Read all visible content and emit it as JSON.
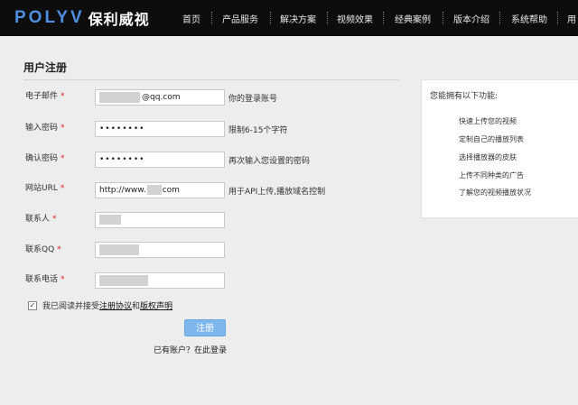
{
  "header": {
    "logo_latin": "POLYV",
    "logo_cn": "保利威视",
    "nav": [
      "首页",
      "产品服务",
      "解决方案",
      "视频效果",
      "经典案例",
      "版本介绍",
      "系统帮助",
      "用"
    ]
  },
  "form": {
    "title": "用户注册",
    "required_mark": "*",
    "fields": [
      {
        "label": "电子邮件",
        "value": "@qq.com",
        "hint": "你的登录账号"
      },
      {
        "label": "输入密码",
        "value": "••••••••",
        "hint": "限制6-15个字符"
      },
      {
        "label": "确认密码",
        "value": "••••••••",
        "hint": "再次输入您设置的密码"
      },
      {
        "label": "网站URL",
        "value_prefix": "http://www.",
        "value_suffix": "com",
        "hint": "用于API上传,播放域名控制"
      },
      {
        "label": "联系人",
        "value": "",
        "hint": ""
      },
      {
        "label": "联系QQ",
        "value": "",
        "hint": ""
      },
      {
        "label": "联系电话",
        "value": "",
        "hint": ""
      }
    ],
    "agree": {
      "checked_glyph": "✓",
      "text": "我已阅读并接受",
      "link1": "注册协议",
      "and": "和",
      "link2": "版权声明"
    },
    "submit_label": "注册",
    "login_link": "已有账户？在此登录"
  },
  "sidebar": {
    "title": "您能拥有以下功能:",
    "features": [
      "快速上传您的视频",
      "定制自己的播放列表",
      "选择播放器的皮肤",
      "上传不同种类的广告",
      "了解您的视频播放状况"
    ]
  }
}
